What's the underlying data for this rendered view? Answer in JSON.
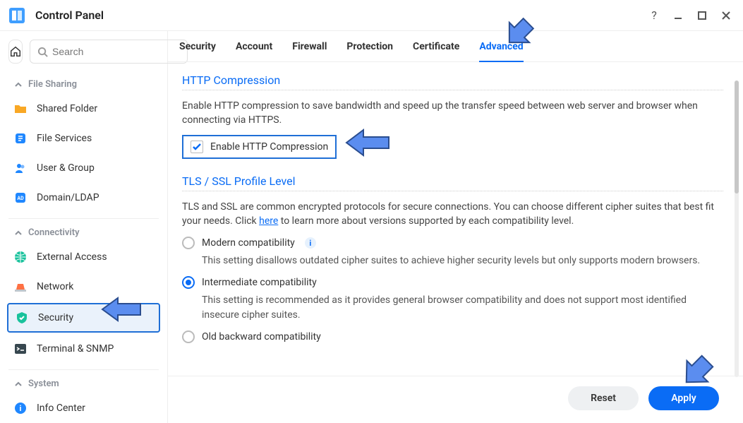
{
  "window": {
    "title": "Control Panel"
  },
  "search": {
    "placeholder": "Search"
  },
  "sidebar": {
    "sections": [
      {
        "label": "File Sharing"
      },
      {
        "label": "Connectivity"
      },
      {
        "label": "System"
      }
    ],
    "items": {
      "shared_folder": "Shared Folder",
      "file_services": "File Services",
      "user_group": "User & Group",
      "domain_ldap": "Domain/LDAP",
      "external_access": "External Access",
      "network": "Network",
      "security": "Security",
      "terminal_snmp": "Terminal & SNMP",
      "info_center": "Info Center"
    }
  },
  "tabs": {
    "security": "Security",
    "account": "Account",
    "firewall": "Firewall",
    "protection": "Protection",
    "certificate": "Certificate",
    "advanced": "Advanced"
  },
  "http_compression": {
    "title": "HTTP Compression",
    "desc": "Enable HTTP compression to save bandwidth and speed up the transfer speed between web server and browser when connecting via HTTPS.",
    "checkbox_label": "Enable HTTP Compression"
  },
  "tls": {
    "title": "TLS / SSL Profile Level",
    "desc_before_link": "TLS and SSL are common encrypted protocols for secure connections. You can choose different cipher suites that best fit your needs. Click ",
    "link_text": "here",
    "desc_after_link": " to learn more about versions supported by each compatibility level.",
    "options": {
      "modern": {
        "label": "Modern compatibility",
        "desc": "This setting disallows outdated cipher suites to achieve higher security levels but only supports modern browsers."
      },
      "intermediate": {
        "label": "Intermediate compatibility",
        "desc": "This setting is recommended as it provides general browser compatibility and does not support most identified insecure cipher suites."
      },
      "old": {
        "label": "Old backward compatibility"
      }
    }
  },
  "footer": {
    "reset": "Reset",
    "apply": "Apply"
  },
  "info_symbol": "i"
}
